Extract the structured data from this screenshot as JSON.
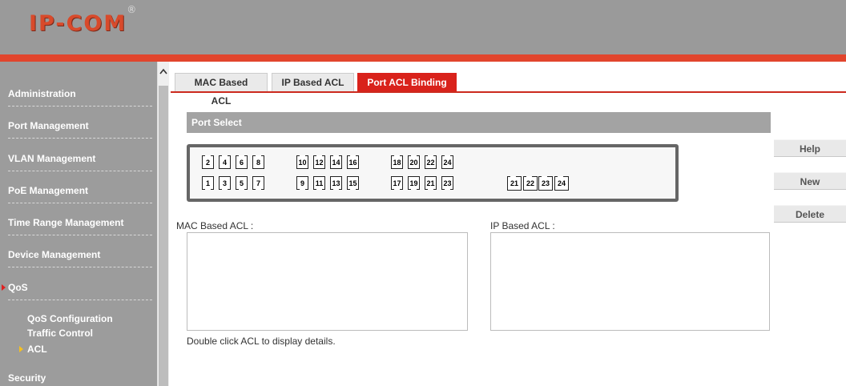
{
  "header": {
    "logo_text": "IP-COM",
    "logo_mark": "®"
  },
  "sidebar": {
    "items": [
      {
        "label": "Administration"
      },
      {
        "label": "Port Management"
      },
      {
        "label": "VLAN Management"
      },
      {
        "label": "PoE Management"
      },
      {
        "label": "Time Range Management"
      },
      {
        "label": "Device Management"
      },
      {
        "label": "QoS"
      }
    ],
    "sub_items": [
      {
        "label": "QoS Configuration"
      },
      {
        "label": "Traffic Control"
      },
      {
        "label": "ACL"
      }
    ],
    "last_item": {
      "label": "Security"
    }
  },
  "tabs": [
    {
      "label": "MAC Based ACL",
      "active": false
    },
    {
      "label": "IP Based ACL",
      "active": false
    },
    {
      "label": "Port ACL Binding",
      "active": true
    }
  ],
  "port_select": {
    "title": "Port Select",
    "top_row": [
      "2",
      "4",
      "6",
      "8",
      "10",
      "12",
      "14",
      "16",
      "18",
      "20",
      "22",
      "24"
    ],
    "bottom_row": [
      "1",
      "3",
      "5",
      "7",
      "9",
      "11",
      "13",
      "15",
      "17",
      "19",
      "21",
      "23"
    ],
    "sfp_row": [
      "21",
      "22",
      "23",
      "24"
    ]
  },
  "mac_acl": {
    "label": "MAC Based ACL :"
  },
  "ip_acl": {
    "label": "IP Based ACL :"
  },
  "hint": "Double click ACL to display details.",
  "buttons": {
    "help": "Help",
    "new": "New",
    "delete": "Delete"
  },
  "colors": {
    "accent": "#d9221b",
    "header": "#9a9a9a",
    "sidebar": "#9c9c9c"
  }
}
